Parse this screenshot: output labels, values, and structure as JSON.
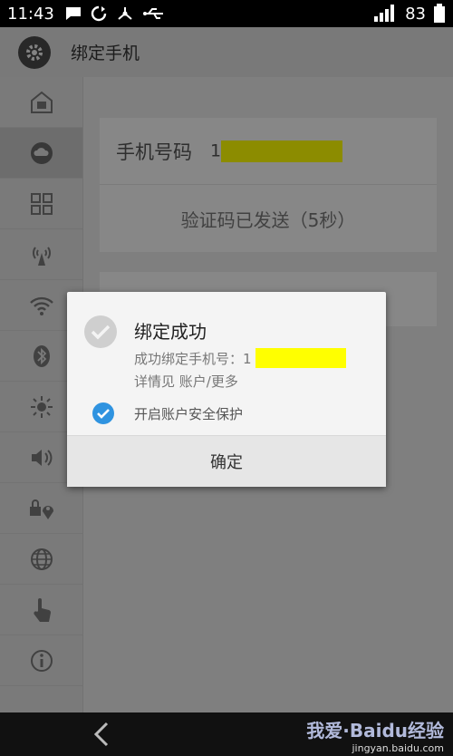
{
  "status_bar": {
    "time": "11:43",
    "battery": "83"
  },
  "app": {
    "title": "绑定手机",
    "sidebar_icons": [
      "home-icon",
      "cloud-icon",
      "grid-icon",
      "hotspot-icon",
      "wifi-icon",
      "bluetooth-icon",
      "brightness-icon",
      "volume-icon",
      "location-lock-icon",
      "globe-icon",
      "touch-icon",
      "info-icon"
    ],
    "phone_label": "手机号码",
    "phone_prefix": "1",
    "code_status": "验证码已发送（5秒）"
  },
  "dialog": {
    "title": "绑定成功",
    "line1": "成功绑定手机号：1",
    "line2": "详情见 账户/更多",
    "checkbox_label": "开启账户安全保护",
    "checkbox_checked": true,
    "ok_label": "确定"
  },
  "watermark": {
    "text": "我爱·Baidu经验",
    "sub": "jingyan.baidu.com"
  }
}
